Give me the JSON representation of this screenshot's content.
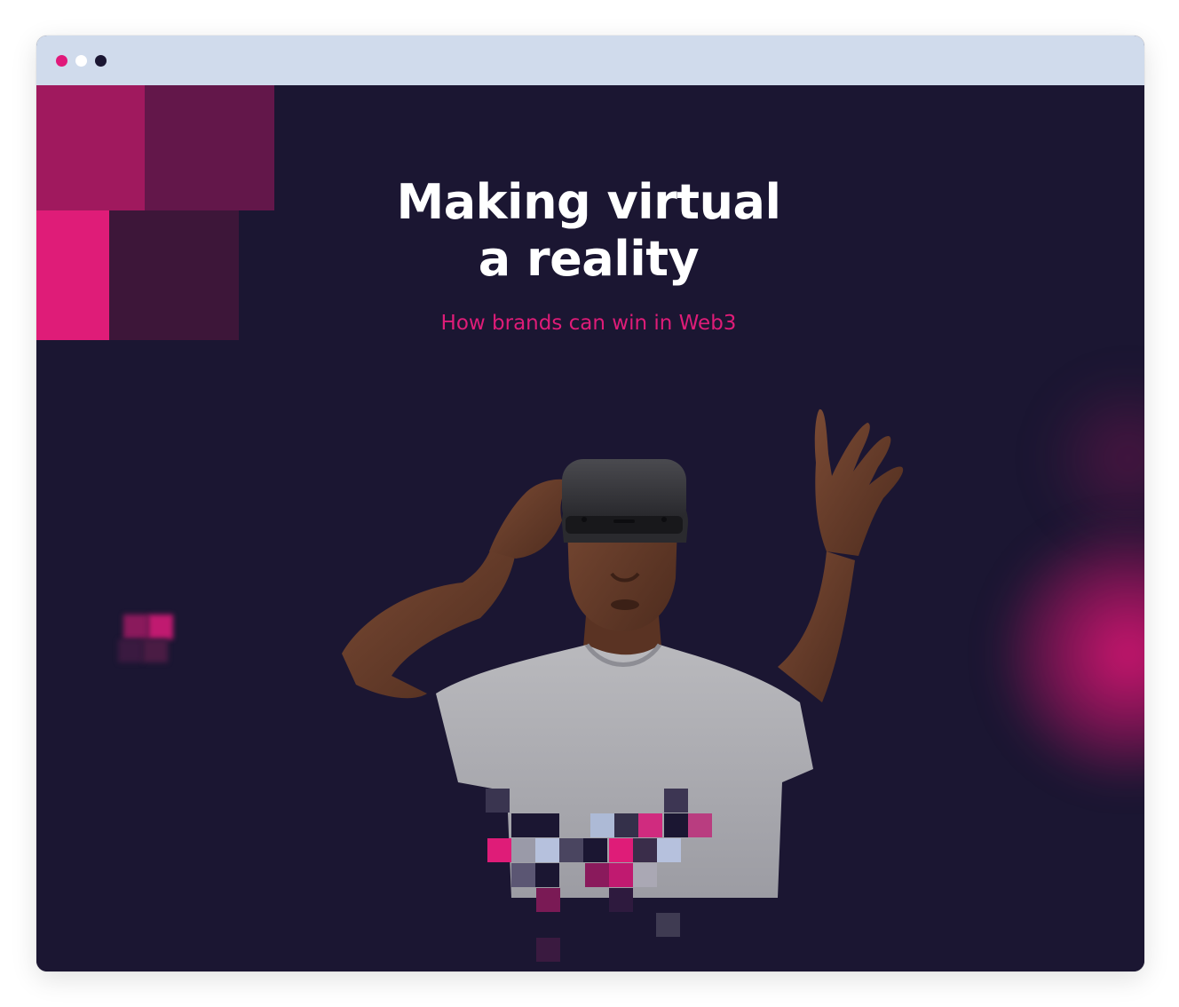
{
  "window": {
    "controls": [
      "close",
      "minimize",
      "maximize"
    ]
  },
  "hero": {
    "title_line1": "Making virtual",
    "title_line2": "a reality",
    "subtitle": "How brands can win in Web3",
    "image_subject": "person-wearing-vr-headset"
  },
  "colors": {
    "background": "#1b1632",
    "accent": "#df1c78",
    "titlebar": "#d0dbec",
    "magenta_dark": "#a0195e",
    "plum": "#63174a"
  }
}
